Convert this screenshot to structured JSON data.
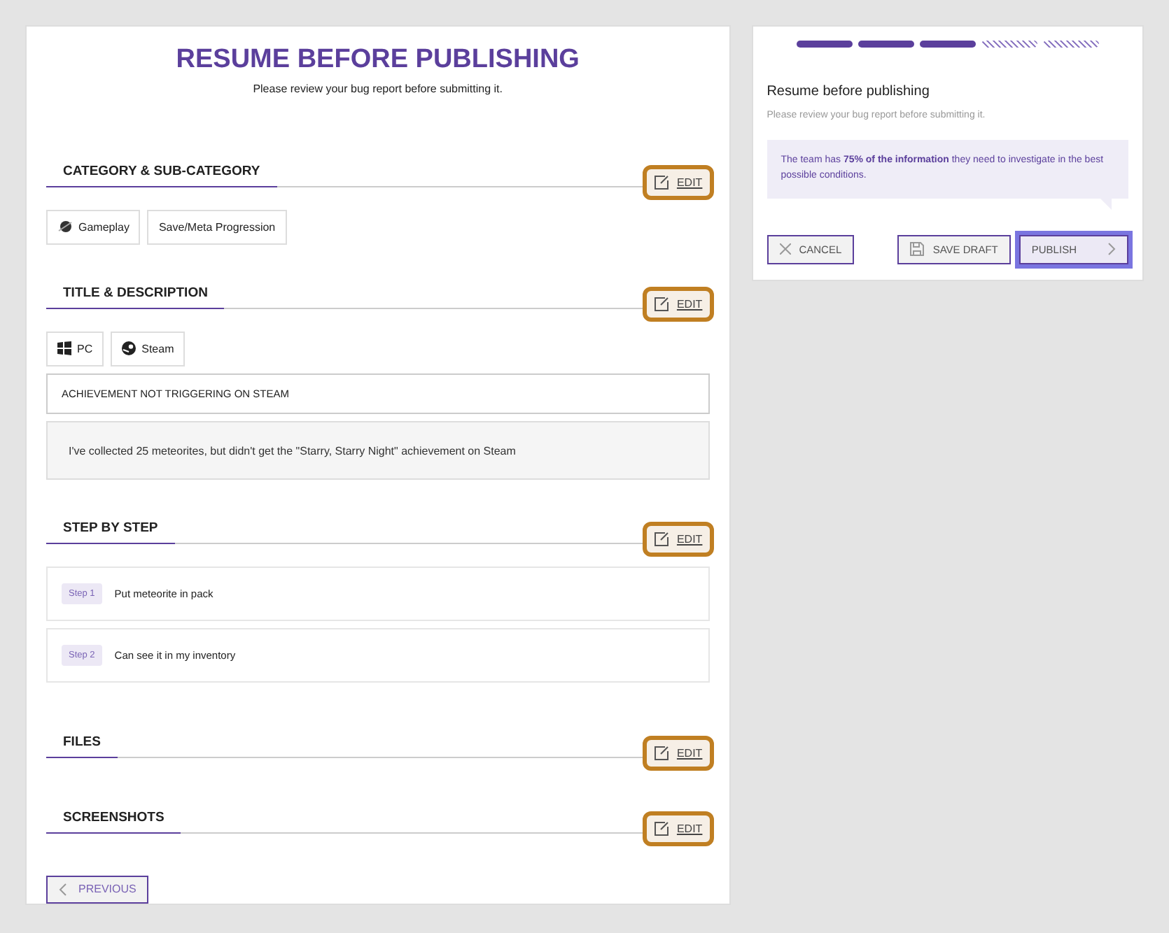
{
  "main": {
    "title": "RESUME BEFORE PUBLISHING",
    "subtitle": "Please review your bug report before submitting it.",
    "sections": [
      {
        "kind": "tags",
        "heading": "CATEGORY & SUB-CATEGORY",
        "edit": {
          "label": "EDIT",
          "highlighted": true
        },
        "tags": [
          {
            "label": "Gameplay",
            "kind": "planet"
          },
          {
            "label": "Save/Meta Progression"
          }
        ]
      },
      {
        "kind": "description",
        "heading": "TITLE & DESCRIPTION",
        "edit": {
          "label": "EDIT",
          "highlighted": true
        },
        "tags": [
          {
            "label": "PC",
            "kind": "windows"
          },
          {
            "label": "Steam",
            "kind": "steam"
          }
        ],
        "report_title": "ACHIEVEMENT NOT TRIGGERING ON STEAM",
        "description": "I've collected 25 meteorites, but didn't get the \"Starry, Starry Night\" achievement on Steam"
      },
      {
        "kind": "steps",
        "heading": "STEP BY STEP",
        "edit": {
          "label": "EDIT",
          "highlighted": true
        },
        "steps": [
          {
            "badge": "Step 1",
            "text": "Put meteorite in pack"
          },
          {
            "badge": "Step 2",
            "text": "Can see it in my inventory"
          }
        ]
      },
      {
        "kind": "empty",
        "heading": "FILES",
        "edit": {
          "label": "EDIT",
          "highlighted": true
        }
      },
      {
        "kind": "empty",
        "heading": "SCREENSHOTS",
        "edit": {
          "label": "EDIT",
          "highlighted": true
        }
      }
    ],
    "previous_button": "PREVIOUS"
  },
  "side": {
    "progress": [
      {
        "done": true
      },
      {
        "done": true
      },
      {
        "done": true
      },
      {
        "done": false
      },
      {
        "done": false
      }
    ],
    "title": "Resume before publishing",
    "subtitle": "Please review your bug report before submitting it.",
    "info": "The team has **75% of the information** they need to investigate in the best possible conditions.",
    "cancel_button": "CANCEL",
    "save_button": "SAVE DRAFT",
    "publish_button": {
      "label": "PUBLISH",
      "focused": true
    }
  }
}
